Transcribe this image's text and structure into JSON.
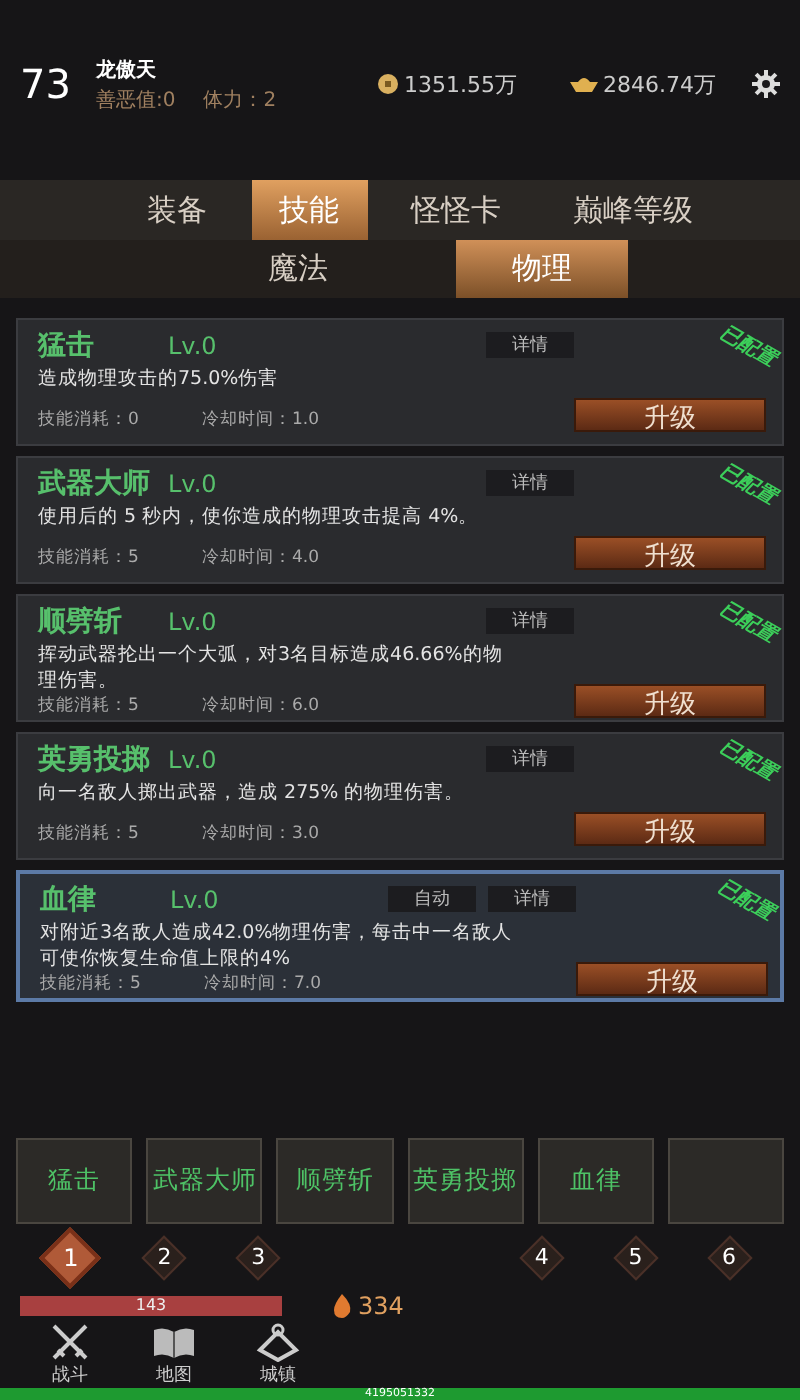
{
  "player": {
    "level": "73",
    "name": "龙傲天",
    "karma": "善恶值:0",
    "stamina": "体力：2",
    "coins": "1351.55万",
    "ingots": "2846.74万"
  },
  "tabs": [
    {
      "label": "装备",
      "selected": false
    },
    {
      "label": "技能",
      "selected": true
    },
    {
      "label": "怪怪卡",
      "selected": false
    },
    {
      "label": "巅峰等级",
      "selected": false
    }
  ],
  "subtabs": [
    {
      "label": "魔法",
      "selected": false
    },
    {
      "label": "物理",
      "selected": true
    }
  ],
  "skills": [
    {
      "name": "猛击",
      "level": "Lv.0",
      "details": "详情",
      "description": "造成物理攻击的75.0%伤害",
      "cost": "技能消耗：0",
      "cooldown": "冷却时间：1.0",
      "upgrade": "升级",
      "configured": "已配置",
      "selected": false
    },
    {
      "name": "武器大师",
      "level": "Lv.0",
      "details": "详情",
      "description": "使用后的 5 秒内，使你造成的物理攻击提高 4%。",
      "cost": "技能消耗：5",
      "cooldown": "冷却时间：4.0",
      "upgrade": "升级",
      "configured": "已配置",
      "selected": false
    },
    {
      "name": "顺劈斩",
      "level": "Lv.0",
      "details": "详情",
      "description": "挥动武器抡出一个大弧，对3名目标造成46.66%的物理伤害。",
      "cost": "技能消耗：5",
      "cooldown": "冷却时间：6.0",
      "upgrade": "升级",
      "configured": "已配置",
      "selected": false
    },
    {
      "name": "英勇投掷",
      "level": "Lv.0",
      "details": "详情",
      "description": "向一名敌人掷出武器，造成 275% 的物理伤害。",
      "cost": "技能消耗：5",
      "cooldown": "冷却时间：3.0",
      "upgrade": "升级",
      "configured": "已配置",
      "selected": false
    },
    {
      "name": "血律",
      "level": "Lv.0",
      "auto": "自动",
      "details": "详情",
      "description": "对附近3名敌人造成42.0%物理伤害，每击中一名敌人可使你恢复生命值上限的4%",
      "cost": "技能消耗：5",
      "cooldown": "冷却时间：7.0",
      "upgrade": "升级",
      "configured": "已配置",
      "selected": true
    }
  ],
  "slots": [
    {
      "kind": "skill",
      "label": "猛击"
    },
    {
      "kind": "skill",
      "label": "武器大师"
    },
    {
      "kind": "skill",
      "label": "顺劈斩"
    },
    {
      "kind": "skill",
      "label": "英勇投掷"
    },
    {
      "kind": "skill",
      "label": "血律"
    },
    {
      "kind": "empty"
    }
  ],
  "pages": [
    {
      "label": "1",
      "selected": true
    },
    {
      "label": "2",
      "selected": false
    },
    {
      "label": "3",
      "selected": false
    },
    {
      "label": "4",
      "selected": false
    },
    {
      "label": "5",
      "selected": false
    },
    {
      "label": "6",
      "selected": false
    }
  ],
  "hp": {
    "value": "143",
    "level": 1
  },
  "power": "334",
  "nav": [
    {
      "kind": "swords",
      "label": "战斗"
    },
    {
      "kind": "book",
      "label": "地图"
    },
    {
      "kind": "town",
      "label": "城镇"
    }
  ],
  "exp": {
    "value": "4195051332",
    "level": 1
  }
}
